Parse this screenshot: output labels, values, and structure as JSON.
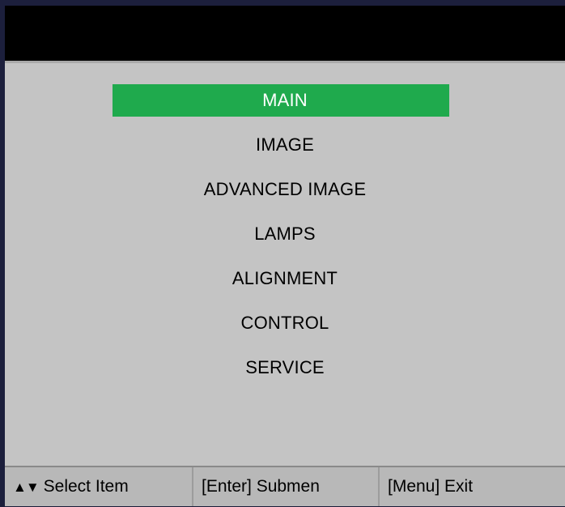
{
  "menu": {
    "items": [
      {
        "label": "MAIN",
        "selected": true
      },
      {
        "label": "IMAGE",
        "selected": false
      },
      {
        "label": "ADVANCED IMAGE",
        "selected": false
      },
      {
        "label": "LAMPS",
        "selected": false
      },
      {
        "label": "ALIGNMENT",
        "selected": false
      },
      {
        "label": "CONTROL",
        "selected": false
      },
      {
        "label": "SERVICE",
        "selected": false
      }
    ]
  },
  "status_bar": {
    "select_arrows": "▲▼",
    "select_text": "Select Item",
    "enter_text": "[Enter] Submen",
    "menu_text": "[Menu] Exit"
  },
  "colors": {
    "highlight": "#1faa4d",
    "panel": "#c4c4c4",
    "title_bar": "#000000"
  }
}
